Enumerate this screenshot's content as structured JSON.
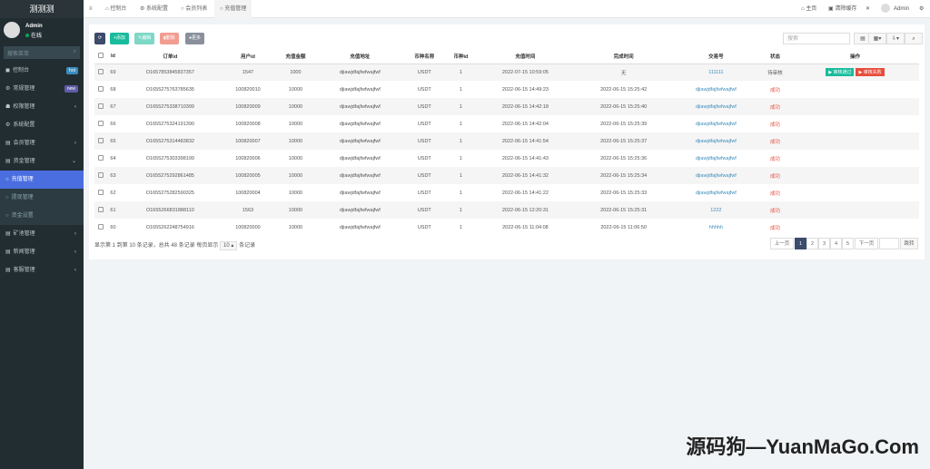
{
  "sidebar": {
    "logo": "测测测",
    "user": "Admin",
    "status": "在线",
    "search_placeholder": "搜索菜单",
    "items": [
      {
        "label": "控制台",
        "icon": "dashboard-icon",
        "badge": "hot",
        "badge_color": "#3c8dbc"
      },
      {
        "label": "常规管理",
        "icon": "cogs-icon",
        "badge": "new",
        "badge_color": "#605ca8"
      },
      {
        "label": "权限管理",
        "icon": "group-icon",
        "arrow": "‹"
      },
      {
        "label": "系统配置",
        "icon": "gear-icon"
      },
      {
        "label": "会员管理",
        "icon": "list-icon",
        "arrow": "‹"
      },
      {
        "label": "资金管理",
        "icon": "list-icon",
        "arrow": "⌄"
      },
      {
        "label": "充值管理",
        "icon": "circle-icon",
        "active": true
      },
      {
        "label": "提现管理",
        "icon": "circle-icon",
        "sub": true
      },
      {
        "label": "资金设置",
        "icon": "circle-icon",
        "sub": true
      },
      {
        "label": "矿池管理",
        "icon": "list-icon",
        "arrow": "‹"
      },
      {
        "label": "新闻管理",
        "icon": "list-icon",
        "arrow": "‹"
      },
      {
        "label": "客服管理",
        "icon": "list-icon",
        "arrow": "‹"
      }
    ]
  },
  "topbar": {
    "tabs": [
      "控制台",
      "系统配置",
      "会员列表",
      "充值管理"
    ],
    "home": "主页",
    "clear_cache": "清除缓存",
    "user": "Admin"
  },
  "toolbar": {
    "add": "添加",
    "edit": "编辑",
    "delete": "删除",
    "more": "更多",
    "search_placeholder": "搜索"
  },
  "table": {
    "columns": [
      "Id",
      "订单id",
      "用户id",
      "充值金额",
      "充值地址",
      "币种名称",
      "币种id",
      "充值时间",
      "完成时间",
      "交易号",
      "状态",
      "操作"
    ],
    "rows": [
      [
        "69",
        "O1657853845837357",
        "1547",
        "1000",
        "djiawjdfajfwfwajfwf",
        "USDT",
        "1",
        "2022-07-15 10:59:05",
        "无",
        "111111",
        "待审核"
      ],
      [
        "68",
        "O1655275763785635",
        "100820010",
        "10000",
        "djiawjdfajfwfwajfwf",
        "USDT",
        "1",
        "2022-06-15 14:49:23",
        "2022-06-15 15:25:42",
        "djiawjdfajfwfwajfwf",
        "成功"
      ],
      [
        "67",
        "O1655275338710399",
        "100820009",
        "10000",
        "djiawjdfajfwfwajfwf",
        "USDT",
        "1",
        "2022-06-15 14:42:18",
        "2022-06-15 15:25:40",
        "djiawjdfajfwfwajfwf",
        "成功"
      ],
      [
        "66",
        "O1655275324191390",
        "100820008",
        "10000",
        "djiawjdfajfwfwajfwf",
        "USDT",
        "1",
        "2022-06-15 14:42:04",
        "2022-06-15 15:25:39",
        "djiawjdfajfwfwajfwf",
        "成功"
      ],
      [
        "65",
        "O1655275314483832",
        "100820007",
        "10000",
        "djiawjdfajfwfwajfwf",
        "USDT",
        "1",
        "2022-06-15 14:41:54",
        "2022-06-15 15:25:37",
        "djiawjdfajfwfwajfwf",
        "成功"
      ],
      [
        "64",
        "O1655275303398199",
        "100820006",
        "10000",
        "djiawjdfajfwfwajfwf",
        "USDT",
        "1",
        "2022-06-15 14:41:43",
        "2022-06-15 15:25:36",
        "djiawjdfajfwfwajfwf",
        "成功"
      ],
      [
        "63",
        "O1655275292861485",
        "100820005",
        "10000",
        "djiawjdfajfwfwajfwf",
        "USDT",
        "1",
        "2022-06-15 14:41:32",
        "2022-06-15 15:25:34",
        "djiawjdfajfwfwajfwf",
        "成功"
      ],
      [
        "62",
        "O1655275282590325",
        "100820004",
        "10000",
        "djiawjdfajfwfwajfwf",
        "USDT",
        "1",
        "2022-06-15 14:41:22",
        "2022-06-15 15:25:33",
        "djiawjdfajfwfwajfwf",
        "成功"
      ],
      [
        "61",
        "O1655266831888110",
        "1563",
        "10000",
        "djiawjdfajfwfwajfwf",
        "USDT",
        "1",
        "2022-06-15 12:20:31",
        "2022-06-15 15:25:31",
        "1222",
        "成功"
      ],
      [
        "60",
        "O1655262248754916",
        "100820000",
        "10000",
        "djiawjdfajfwfwajfwf",
        "USDT",
        "1",
        "2022-06-15 11:04:08",
        "2022-06-15 11:06:50",
        "hhhhh",
        "成功"
      ]
    ],
    "approve": "审核通过",
    "reject": "审核失败"
  },
  "footer": {
    "summary": "显示第 1 到第 10 条记录，总共 48 条记录 每页显示",
    "page_size": "10",
    "suffix": "条记录"
  },
  "pagination": {
    "prev": "上一页",
    "pages": [
      "1",
      "2",
      "3",
      "4",
      "5"
    ],
    "current": "1",
    "next": "下一页",
    "go": "跳转"
  },
  "watermark": "源码狗—YuanMaGo.Com"
}
